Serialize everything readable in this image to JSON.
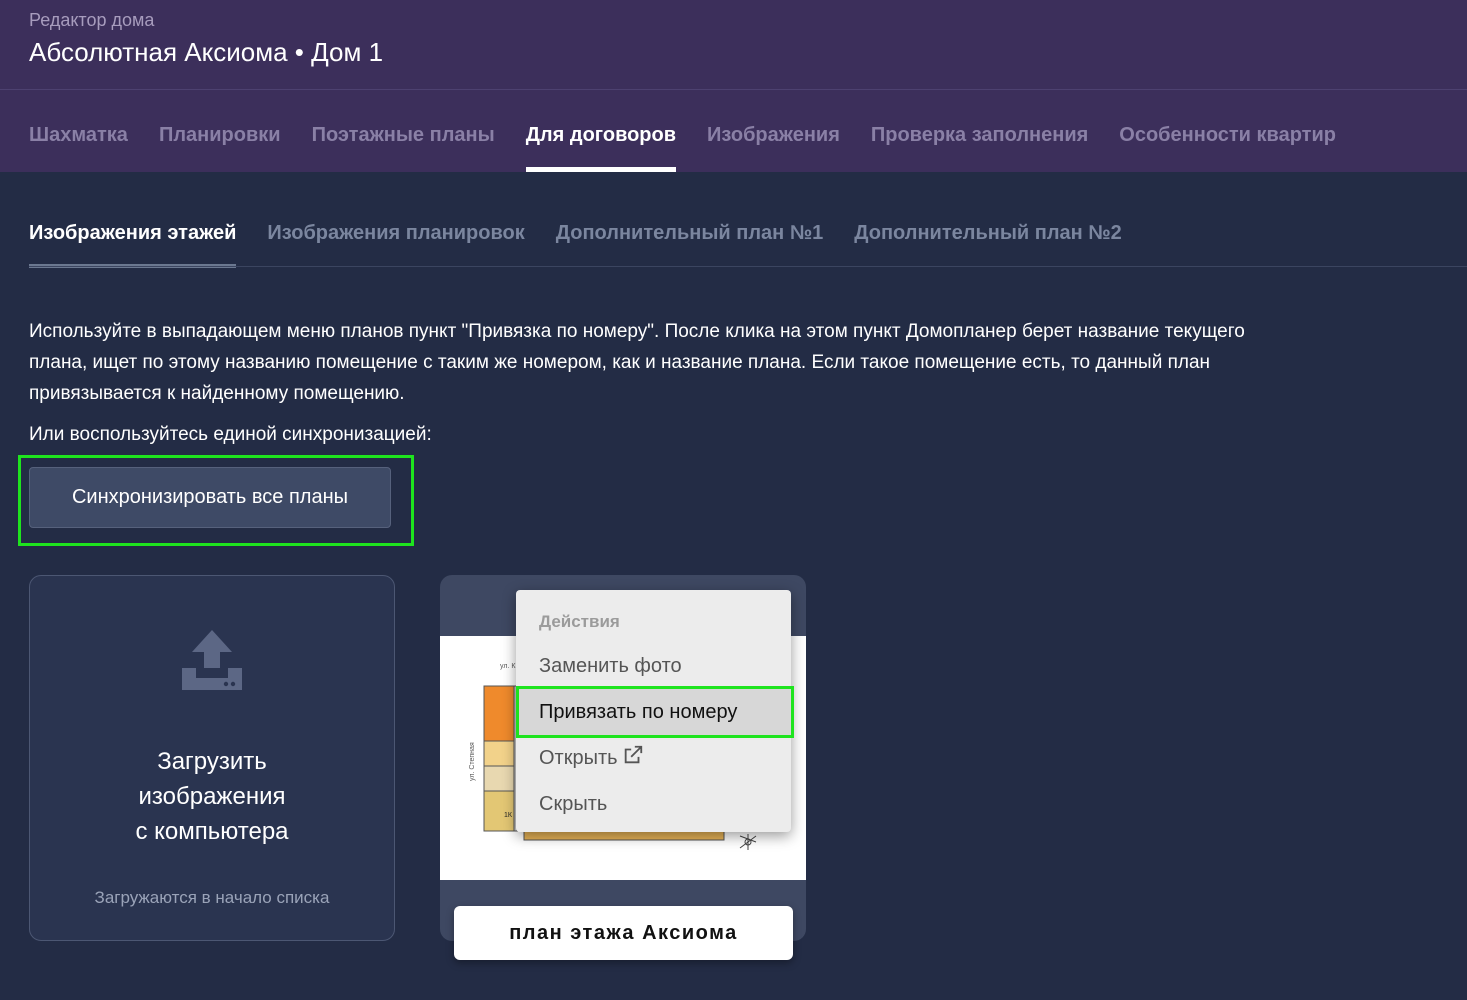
{
  "header": {
    "subtitle": "Редактор дома",
    "title": "Абсолютная Аксиома • Дом 1",
    "tabs": [
      {
        "label": "Шахматка"
      },
      {
        "label": "Планировки"
      },
      {
        "label": "Поэтажные планы"
      },
      {
        "label": "Для договоров"
      },
      {
        "label": "Изображения"
      },
      {
        "label": "Проверка заполнения"
      },
      {
        "label": "Особенности квартир"
      }
    ]
  },
  "subtabs": [
    {
      "label": "Изображения этажей"
    },
    {
      "label": "Изображения планировок"
    },
    {
      "label": "Дополнительный план №1"
    },
    {
      "label": "Дополнительный план №2"
    }
  ],
  "description": "Используйте в выпадающем меню планов пункт \"Привязка по номеру\". После клика на этом пункт Домопланер берет название текущего плана, ищет по этому названию помещение с таким же номером, как и название плана. Если такое помещение есть, то данный план привязывается к найденному помещению.",
  "sync": {
    "prompt": "Или воспользуйтесь единой синхронизацией:",
    "button_label": "Синхронизировать все планы"
  },
  "upload": {
    "title_line1": "Загрузить",
    "title_line2": "изображения",
    "title_line3": "с компьютера",
    "note": "Загружаются в начало списка",
    "icon": "upload-tray-icon"
  },
  "plan_card": {
    "label": "план этажа Аксиома",
    "image_labels": {
      "street1": "ул. К",
      "street2": "ул. Степная",
      "room": "1К"
    }
  },
  "menu": {
    "header": "Действия",
    "items": [
      {
        "label": "Заменить фото"
      },
      {
        "label": "Привязать по номеру"
      },
      {
        "label": "Открыть"
      },
      {
        "label": "Скрыть"
      }
    ],
    "external_icon": "external-link-icon"
  },
  "colors": {
    "background": "#232c45",
    "header": "#3c2f5b",
    "highlight": "#1ee41e"
  }
}
